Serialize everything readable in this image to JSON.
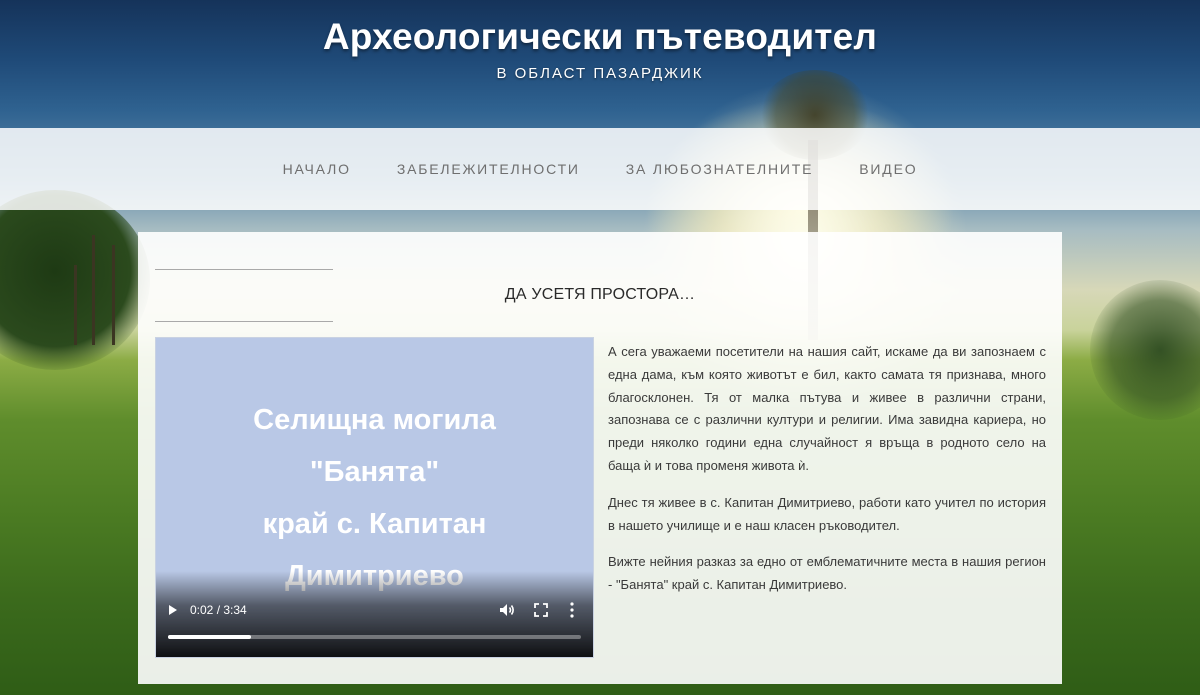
{
  "header": {
    "title": "Археологически пътеводител",
    "subtitle": "В ОБЛАСТ ПАЗАРДЖИК"
  },
  "nav": {
    "items": [
      {
        "label": "НАЧАЛО"
      },
      {
        "label": "ЗАБЕЛЕЖИТЕЛНОСТИ"
      },
      {
        "label": "ЗА ЛЮБОЗНАТЕЛНИТЕ"
      },
      {
        "label": "ВИДЕО"
      }
    ]
  },
  "main": {
    "section_title": "ДА УСЕТЯ ПРОСТОРА…",
    "video": {
      "title_lines": [
        "Селищна могила",
        "\"Банята\"",
        "край с. Капитан",
        "Димитриево"
      ],
      "time": "0:02 / 3:34",
      "progress": 0.2,
      "background_color": "#b9c8e6"
    },
    "paragraphs": [
      "А сега уважаеми посетители на нашия сайт, искаме да ви запознаем с една дама, към която животът е бил, както самата тя признава, много благосклонен. Тя от малка пътува и живее в различни страни, запознава се с различни култури и религии. Има завидна кариера, но преди няколко години една случайност я връща в родното село на баща ѝ и това променя живота ѝ.",
      "Днес тя живее в с. Капитан Димитриево, работи като учител по история в нашето училище и е наш класен ръководител.",
      "Вижте нейния разказ за едно от емблематичните места в нашия регион - \"Банята\" край с. Капитан Димитриево."
    ]
  },
  "icons": {
    "play": "play-icon",
    "volume": "volume-icon",
    "fullscreen": "fullscreen-icon",
    "more": "more-vertical-icon"
  }
}
